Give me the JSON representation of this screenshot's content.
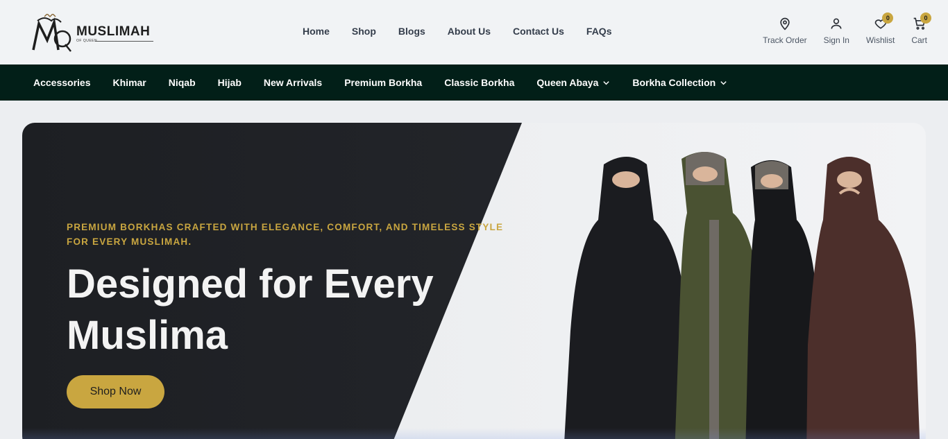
{
  "brand": {
    "name": "MUSLIMAH",
    "sub": "OF QUEEN"
  },
  "main_nav": [
    "Home",
    "Shop",
    "Blogs",
    "About Us",
    "Contact Us",
    "FAQs"
  ],
  "utilities": {
    "track": {
      "label": "Track Order",
      "icon": "map-pin-icon"
    },
    "signin": {
      "label": "Sign In",
      "icon": "user-icon"
    },
    "wishlist": {
      "label": "Wishlist",
      "icon": "heart-icon",
      "count": "0"
    },
    "cart": {
      "label": "Cart",
      "icon": "cart-icon",
      "count": "0"
    }
  },
  "categories": [
    {
      "label": "Accessories",
      "dropdown": false
    },
    {
      "label": "Khimar",
      "dropdown": false
    },
    {
      "label": "Niqab",
      "dropdown": false
    },
    {
      "label": "Hijab",
      "dropdown": false
    },
    {
      "label": "New Arrivals",
      "dropdown": false
    },
    {
      "label": "Premium Borkha",
      "dropdown": false
    },
    {
      "label": "Classic Borkha",
      "dropdown": false
    },
    {
      "label": "Queen Abaya",
      "dropdown": true
    },
    {
      "label": "Borkha Collection",
      "dropdown": true
    }
  ],
  "hero": {
    "tagline": "PREMIUM BORKHAS CRAFTED WITH ELEGANCE, COMFORT, AND TIMELESS STYLE FOR EVERY MUSLIMAH.",
    "title": "Designed for Every Muslima",
    "cta": "Shop Now"
  },
  "colors": {
    "accent": "#c9a640",
    "category_bar": "#021f18",
    "hero_dark": "#1d1f23",
    "nav_text": "#343d4b"
  }
}
